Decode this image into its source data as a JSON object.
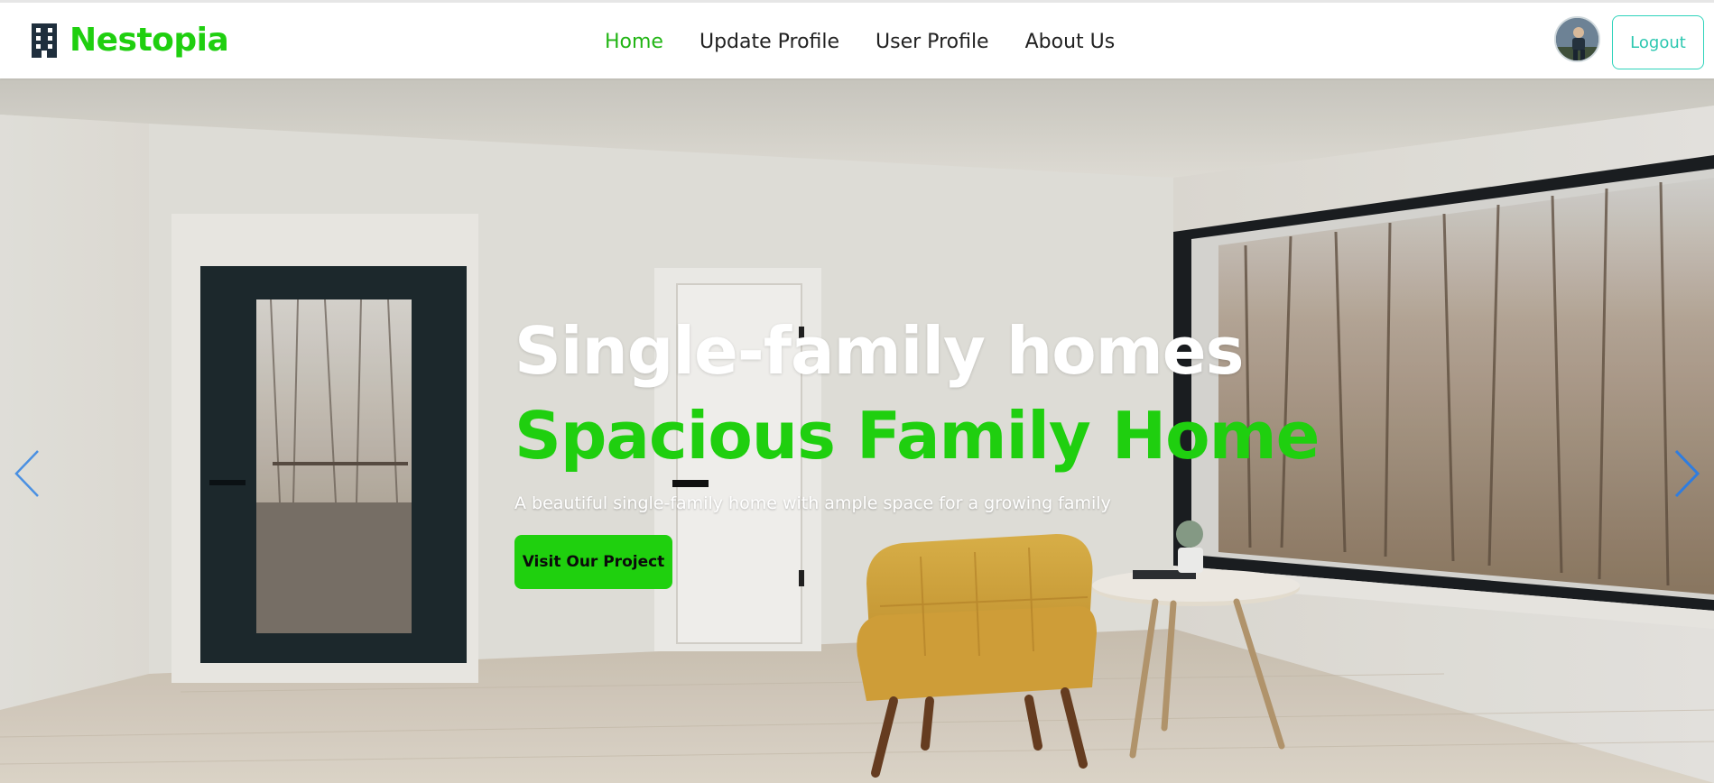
{
  "brand": {
    "name": "Nestopia",
    "icon": "building-icon"
  },
  "nav": {
    "links": [
      {
        "label": "Home",
        "active": true
      },
      {
        "label": "Update Profile",
        "active": false
      },
      {
        "label": "User Profile",
        "active": false
      },
      {
        "label": "About Us",
        "active": false
      }
    ]
  },
  "user": {
    "avatar": "user-avatar",
    "logout_label": "Logout"
  },
  "hero": {
    "title": "Single-family homes",
    "subtitle": "Spacious Family Home",
    "description": "A beautiful single-family home with ample space for a growing family",
    "cta_label": "Visit Our Project"
  },
  "carousel": {
    "prev_icon": "chevron-left-icon",
    "next_icon": "chevron-right-icon"
  },
  "colors": {
    "accent": "#1fcf0f",
    "active_link": "#22b515",
    "logout": "#2cc7b0"
  }
}
